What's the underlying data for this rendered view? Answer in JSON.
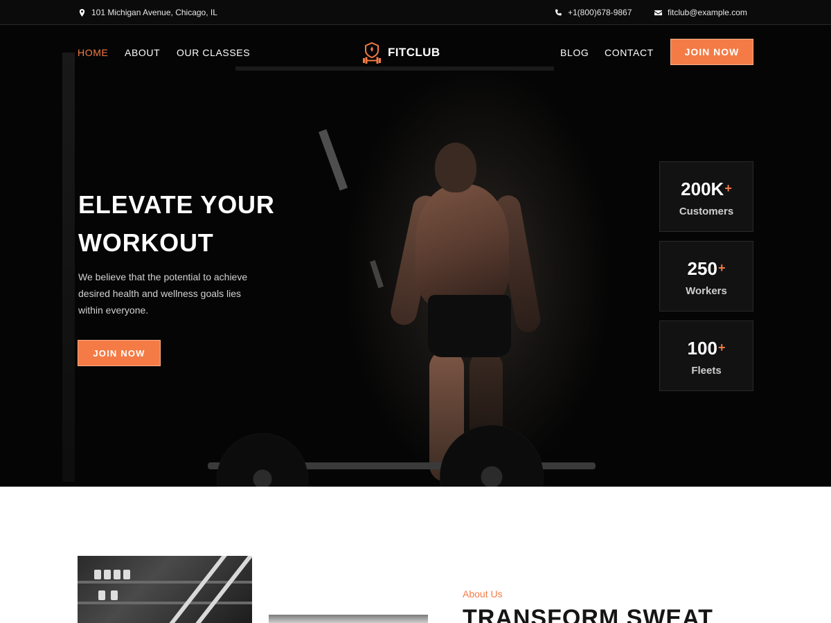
{
  "topbar": {
    "address": "101 Michigan Avenue, Chicago, IL",
    "phone": "+1(800)678-9867",
    "email": "fitclub@example.com"
  },
  "nav": {
    "home": "HOME",
    "about": "ABOUT",
    "classes": "OUR CLASSES",
    "blog": "BLOG",
    "contact": "CONTACT",
    "brand": "FITCLUB",
    "join": "JOIN NOW"
  },
  "hero": {
    "title_line1": "ELEVATE YOUR",
    "title_line2": "WORKOUT",
    "description": "We believe that the potential to achieve desired health and wellness goals lies within everyone.",
    "cta": "JOIN NOW"
  },
  "stats": [
    {
      "value": "200K",
      "plus": "+",
      "label": "Customers"
    },
    {
      "value": "250",
      "plus": "+",
      "label": "Workers"
    },
    {
      "value": "100",
      "plus": "+",
      "label": "Fleets"
    }
  ],
  "about": {
    "tag": "About Us",
    "title": "TRANSFORM SWEAT"
  },
  "colors": {
    "accent": "#f47b45",
    "dark": "#0b0b0b"
  },
  "icons": [
    "map-pin-icon",
    "phone-icon",
    "envelope-icon",
    "dumbbell-shield-logo-icon"
  ]
}
